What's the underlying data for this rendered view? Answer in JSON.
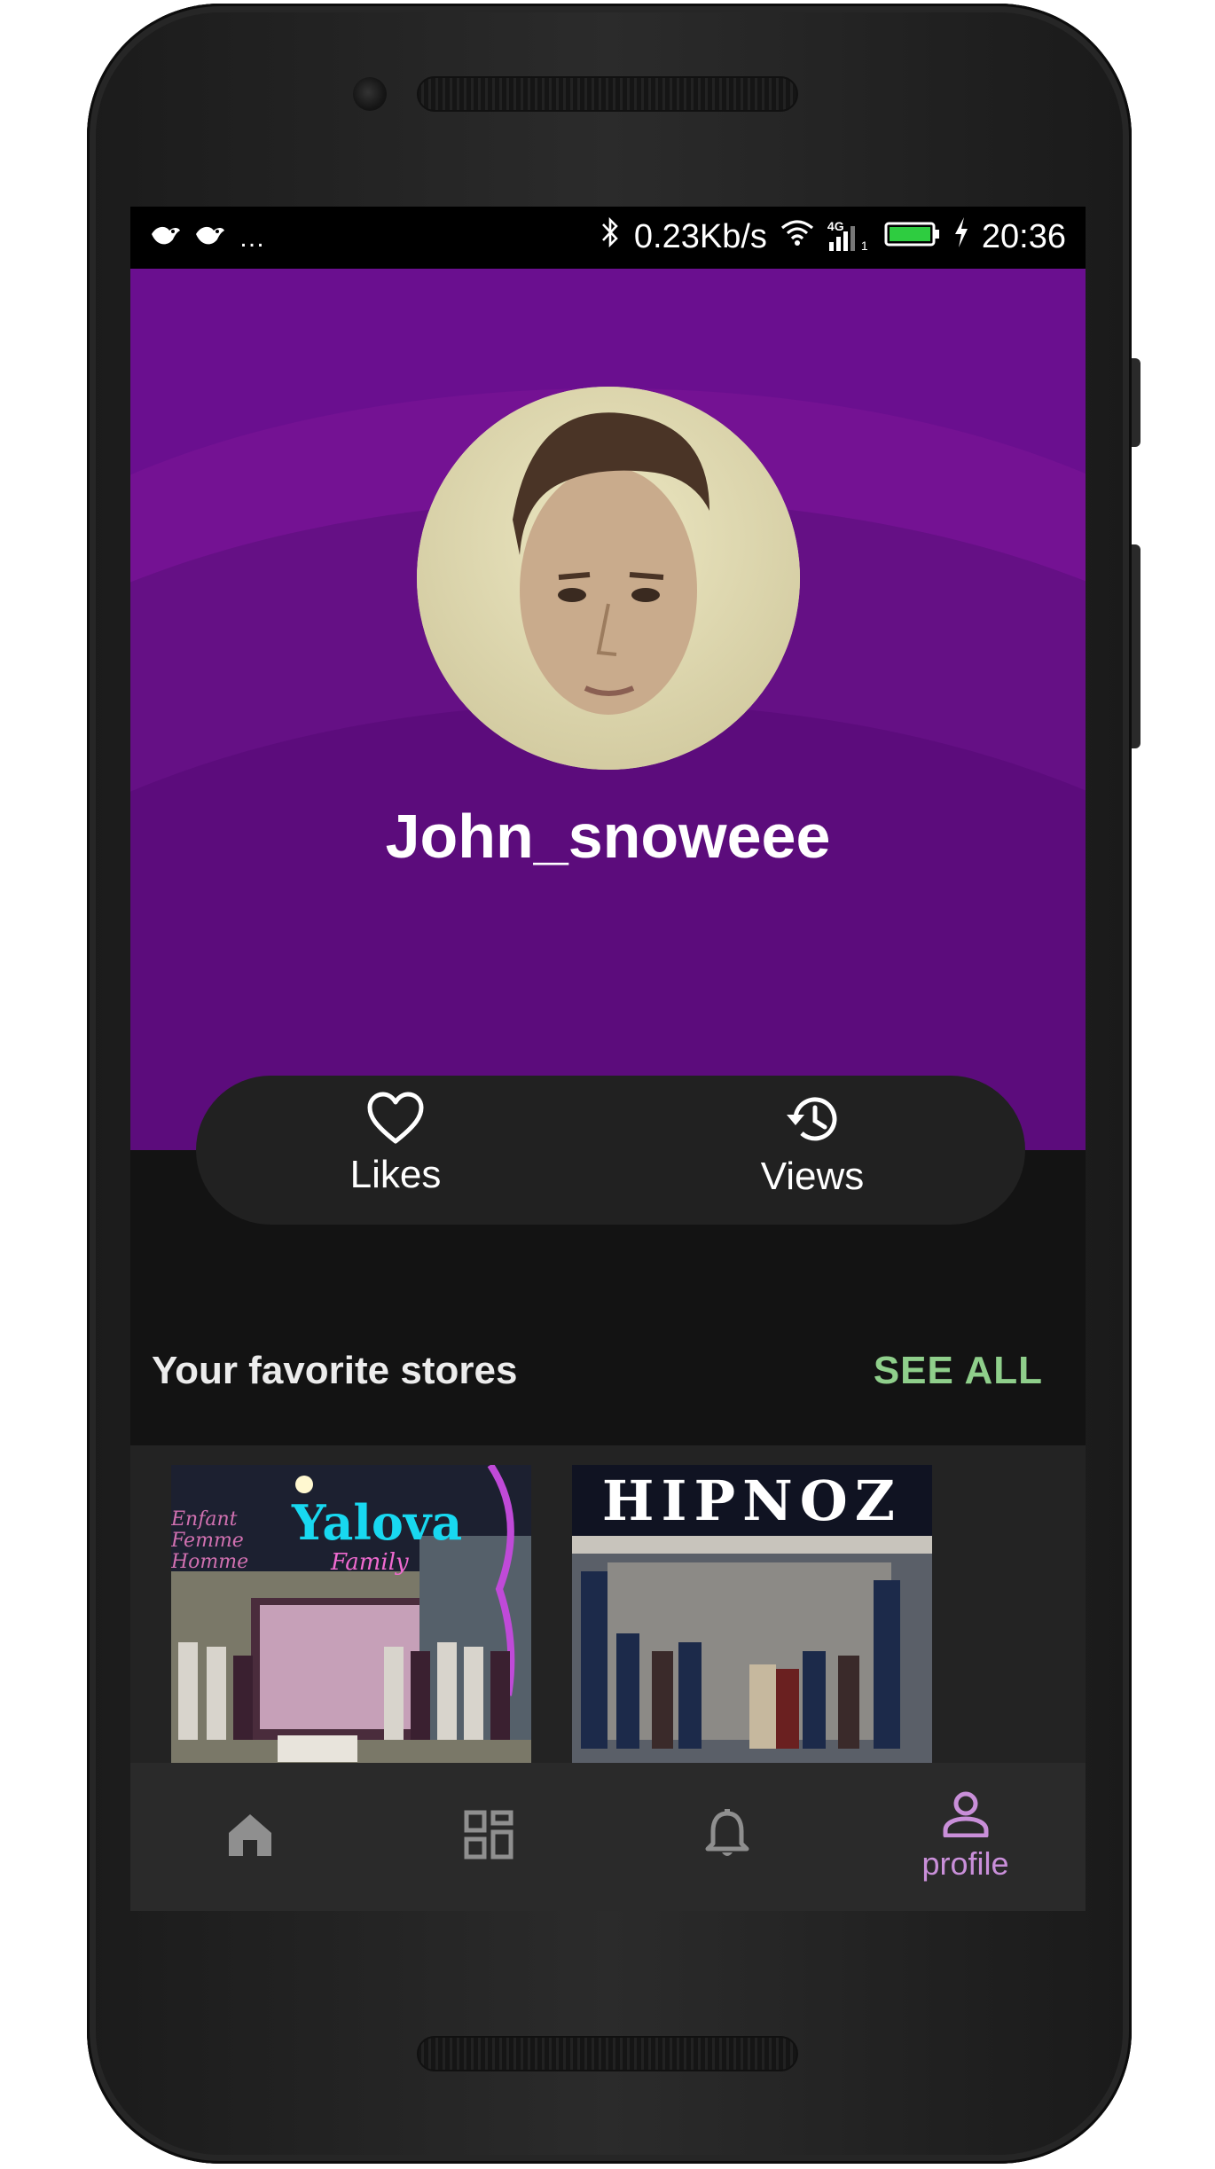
{
  "status_bar": {
    "network_speed": "0.23Kb/s",
    "network_type": "4G",
    "sim_slot": "1",
    "time": "20:36",
    "more_indicator": "…",
    "icons": [
      "notification-bird-icon",
      "notification-bird-icon",
      "bluetooth-icon",
      "wifi-icon",
      "signal-icon",
      "battery-icon",
      "charging-icon"
    ]
  },
  "profile": {
    "username": "John_snoweee"
  },
  "stats": {
    "likes_label": "Likes",
    "views_label": "Views"
  },
  "favorites": {
    "title": "Your favorite stores",
    "see_all_label": "SEE ALL",
    "stores": [
      {
        "sign_text": "Yalova",
        "sign_subtext": "Family",
        "side_text": [
          "Enfant",
          "Femme",
          "Homme"
        ]
      },
      {
        "sign_text": "HIPNOZ"
      }
    ]
  },
  "bottom_nav": {
    "active": "profile",
    "items": [
      {
        "icon": "home-icon",
        "label": ""
      },
      {
        "icon": "dashboard-icon",
        "label": ""
      },
      {
        "icon": "bell-icon",
        "label": ""
      },
      {
        "icon": "person-icon",
        "label": "profile"
      }
    ]
  },
  "colors": {
    "header_purple": "#6a0f8f",
    "background": "#131313",
    "accent_green": "#8fcf8b",
    "active_nav": "#c98fd9",
    "battery_green": "#2ecc40"
  }
}
